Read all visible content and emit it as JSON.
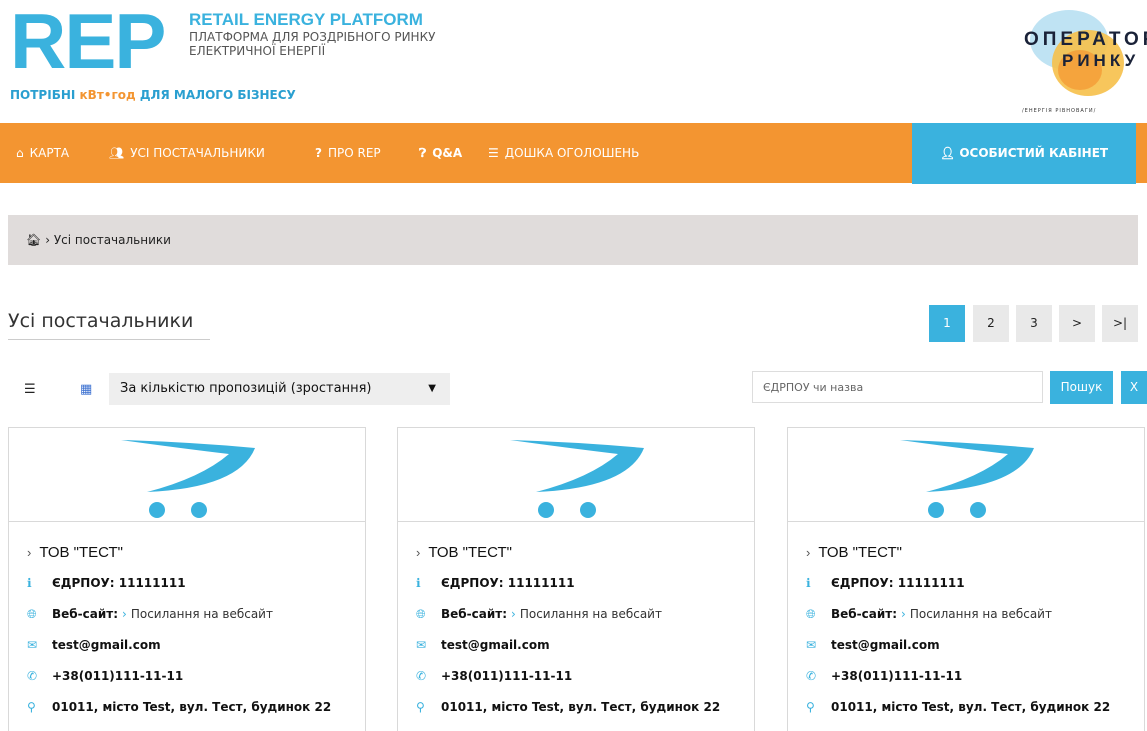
{
  "header": {
    "logo": "REP",
    "brand_title": "RETAIL ENERGY PLATFORM",
    "brand_sub1": "ПЛАТФОРМА ДЛЯ РОЗДРІБНОГО РИНКУ",
    "brand_sub2": "ЕЛЕКТРИЧНОЇ ЕНЕРГІЇ",
    "tagline_pre": "ПОТРІБНІ ",
    "tagline_hl": "кВт•год",
    "tagline_post": " ДЛЯ МАЛОГО БІЗНЕСУ",
    "operator_line1": "ОПЕРАТОР",
    "operator_line2": "РИНКУ",
    "operator_line3": "/ЕНЕРГІЯ РІВНОВАГИ/"
  },
  "nav": {
    "items": [
      {
        "icon": "home-icon",
        "label": "КАРТА"
      },
      {
        "icon": "users-icon",
        "label": "УСІ ПОСТАЧАЛЬНИКИ"
      },
      {
        "icon": "question-icon",
        "label": "ПРО REP"
      },
      {
        "icon": "help-circle-icon",
        "label": "Q&A"
      },
      {
        "icon": "list-icon",
        "label": "ДОШКА ОГОЛОШЕНЬ"
      }
    ],
    "cabinet": "ОСОБИСТИЙ КАБІНЕТ"
  },
  "breadcrumb": {
    "current": "Усі постачальники"
  },
  "page_title": "Усі постачальники",
  "pagination": [
    "1",
    "2",
    "3",
    ">",
    ">|"
  ],
  "toolbar": {
    "sort_value": "За кількістю пропозицій (зростання)",
    "search_placeholder": "ЄДРПОУ чи назва",
    "search_button": "Пошук",
    "clear_button": "X"
  },
  "cards": [
    {
      "name": "ТОВ \"ТЕСТ\"",
      "edrpou": "ЄДРПОУ: 11111111",
      "website_label": "Веб-сайт:",
      "website_link": "Посилання на вебсайт",
      "email": "test@gmail.com",
      "phone": "+38(011)111-11-11",
      "address": "01011, місто Test, вул. Тест, будинок 22"
    },
    {
      "name": "ТОВ \"ТЕСТ\"",
      "edrpou": "ЄДРПОУ: 11111111",
      "website_label": "Веб-сайт:",
      "website_link": "Посилання на вебсайт",
      "email": "test@gmail.com",
      "phone": "+38(011)111-11-11",
      "address": "01011, місто Test, вул. Тест, будинок 22"
    },
    {
      "name": "ТОВ \"ТЕСТ\"",
      "edrpou": "ЄДРПОУ: 11111111",
      "website_label": "Веб-сайт:",
      "website_link": "Посилання на вебсайт",
      "email": "test@gmail.com",
      "phone": "+38(011)111-11-11",
      "address": "01011, місто Test, вул. Тест, будинок 22"
    }
  ],
  "colors": {
    "accent_blue": "#3ab2de",
    "nav_orange": "#f39531",
    "breadcrumb_bg": "#e0dcdb"
  }
}
